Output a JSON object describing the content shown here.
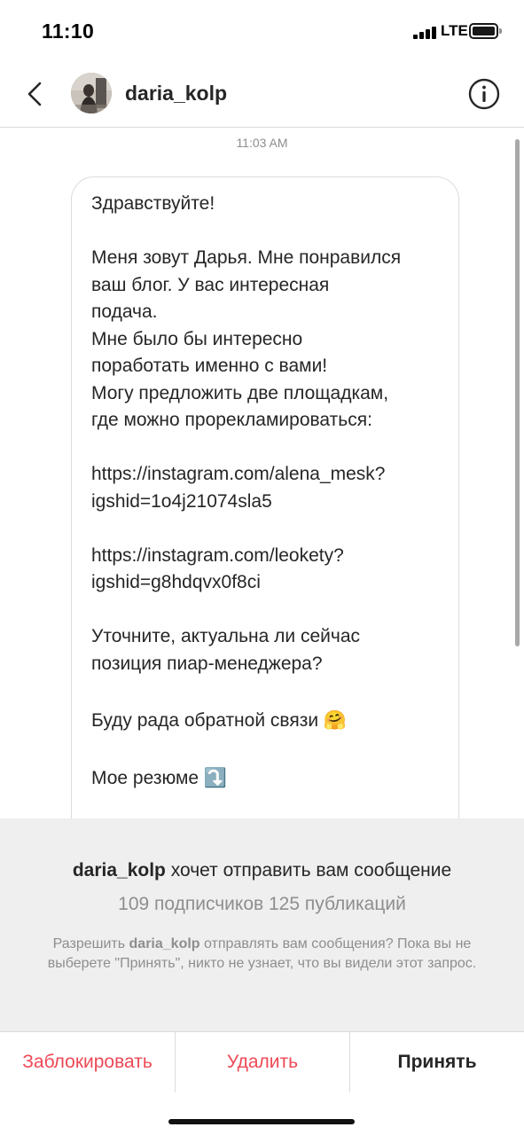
{
  "status_bar": {
    "time": "11:10",
    "network": "LTE"
  },
  "header": {
    "username": "daria_kolp",
    "back_icon": "chevron-left-icon",
    "info_icon": "info-icon"
  },
  "thread": {
    "timestamp": "11:03 AM",
    "message": {
      "paragraphs": [
        "Здравствуйте!",
        "Меня зовут Дарья. Мне понравился\nваш блог. У вас интересная\nподача.\nМне было бы интересно\nпоработать именно с вами!\nМогу предложить две площадкам,\nгде можно прорекламироваться:",
        "https://instagram.com/alena_mesk?\nigshid=1o4j21074sla5",
        "https://instagram.com/leokety?\nigshid=g8hdqvx0f8ci",
        "Уточните, актуальна ли сейчас\nпозиция пиар-менеджера?",
        "Буду рада обратной связи",
        "Мое резюме"
      ],
      "emoji_hug": "🤗",
      "emoji_arrow": "⤵️"
    }
  },
  "request": {
    "username": "daria_kolp",
    "title_rest": " хочет отправить вам сообщение",
    "stats": "109 подписчиков 125 публикаций",
    "info_before": "Разрешить ",
    "info_username": "daria_kolp",
    "info_after": " отправлять вам сообщения? Пока вы не выберете \"Принять\", никто не узнает, что вы видели этот запрос."
  },
  "actions": {
    "block_label": "Заблокировать",
    "delete_label": "Удалить",
    "accept_label": "Принять"
  },
  "colors": {
    "destructive": "#ed4956",
    "panel_bg": "#efefef",
    "secondary_text": "#8e8e8e"
  }
}
